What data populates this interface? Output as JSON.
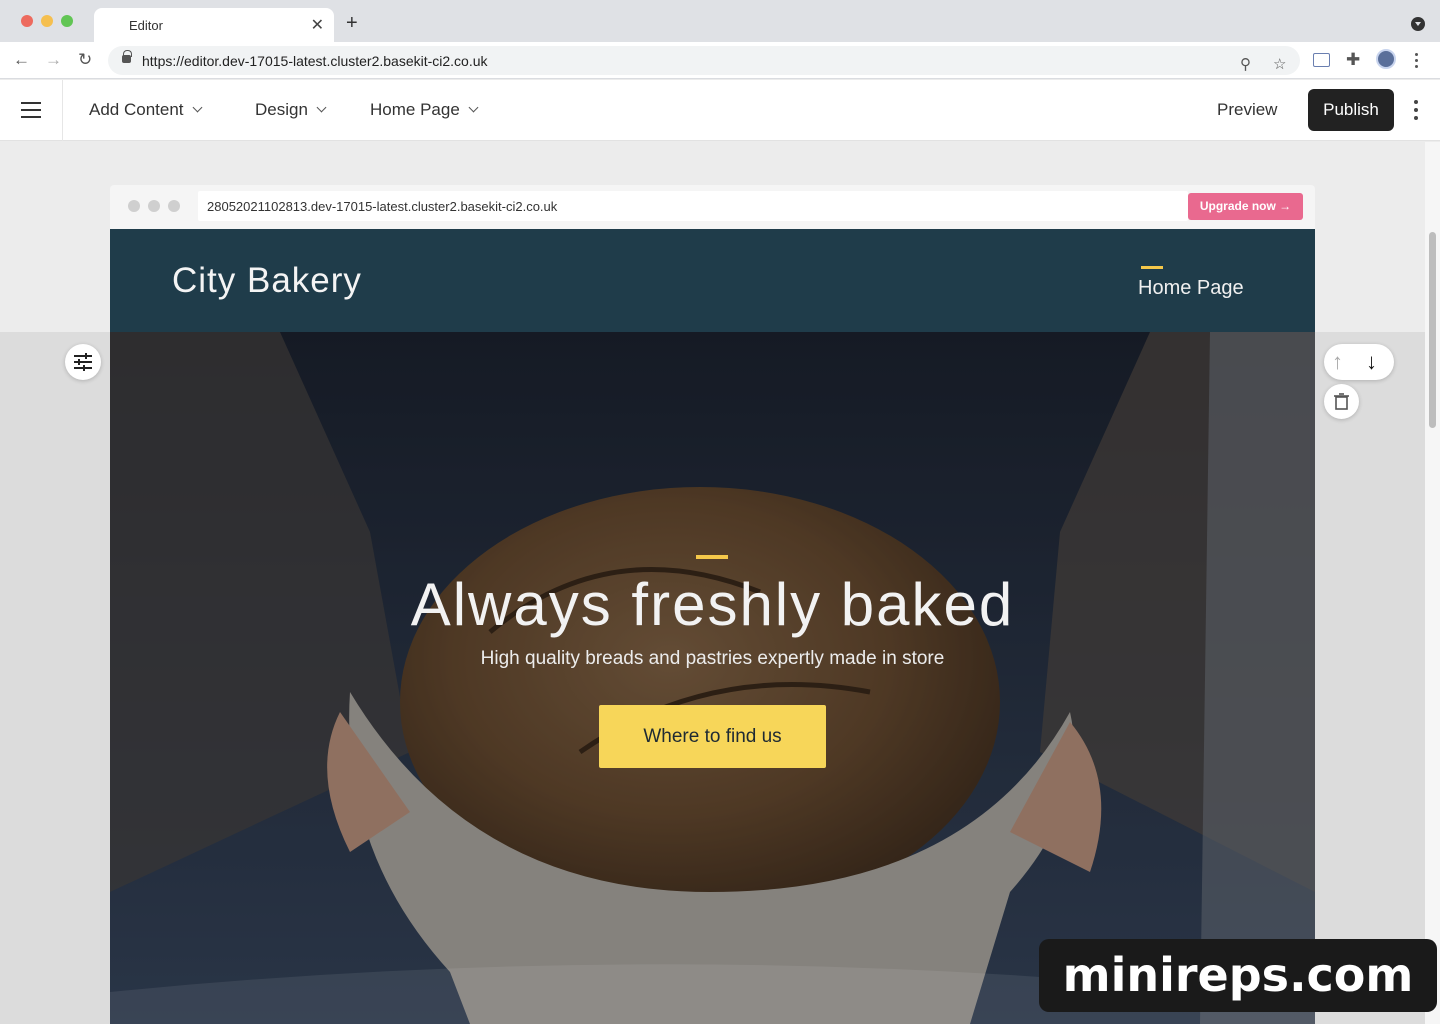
{
  "browser": {
    "tab_title": "Editor",
    "tab_close": "✕",
    "new_tab": "+",
    "url": "https://editor.dev-17015-latest.cluster2.basekit-ci2.co.uk",
    "back": "←",
    "forward": "→",
    "reload": "↻",
    "zoom_icon": "⚲",
    "star_icon": "☆",
    "ext_icon": "✚"
  },
  "toolbar": {
    "menus": [
      "Add Content",
      "Design",
      "Home Page"
    ],
    "preview": "Preview",
    "publish": "Publish"
  },
  "frame": {
    "url": "28052021102813.dev-17015-latest.cluster2.basekit-ci2.co.uk",
    "upgrade": "Upgrade now →"
  },
  "site": {
    "brand": "City Bakery",
    "nav_item": "Home Page"
  },
  "hero": {
    "headline": "Always freshly baked",
    "subtitle": "High quality breads and pastries expertly made in store",
    "cta": "Where to find us"
  },
  "controls": {
    "move_up": "↑",
    "move_down": "↓"
  },
  "watermark": "minireps.com",
  "colors": {
    "header_bg": "#1f3c4a",
    "accent_yellow": "#f7d659",
    "upgrade_pink": "#e9698f",
    "publish_bg": "#222222"
  }
}
